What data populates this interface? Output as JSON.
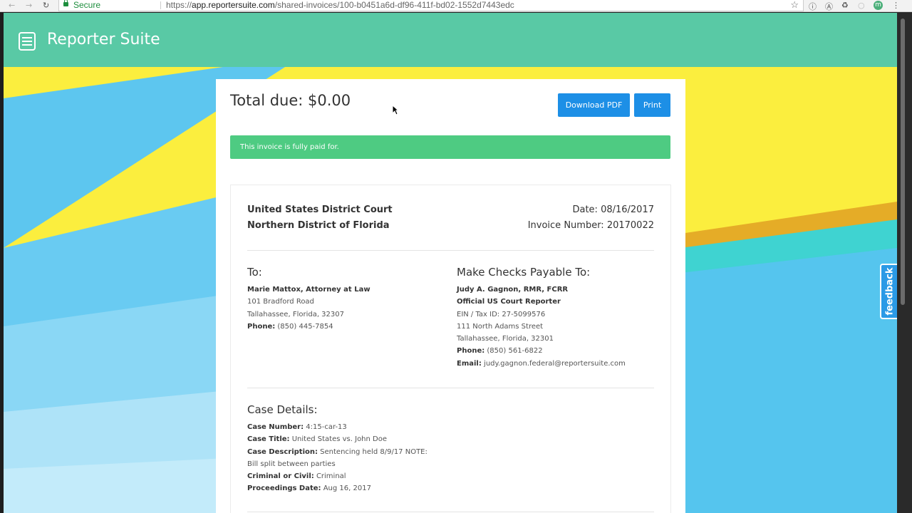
{
  "browser": {
    "secure_label": "Secure",
    "url_scheme": "https://",
    "url_host": "app.reportersuite.com",
    "url_path": "/shared-invoices/100-b0451a6d-df96-411f-bd02-1552d7443edc"
  },
  "app": {
    "brand": "Reporter Suite"
  },
  "feedback": {
    "label": "feedback"
  },
  "invoice": {
    "total_due": "Total due: $0.00",
    "download_label": "Download PDF",
    "print_label": "Print",
    "status_message": "This invoice is fully paid for.",
    "court": {
      "line1": "United States District Court",
      "line2": "Northern District of Florida"
    },
    "date": "Date: 08/16/2017",
    "invoice_number": "Invoice Number: 20170022",
    "to": {
      "heading": "To:",
      "name": "Marie Mattox, Attorney at Law",
      "street": "101 Bradford Road",
      "city": "Tallahassee, Florida, 32307",
      "phone_label": "Phone:",
      "phone": "(850) 445-7854"
    },
    "payable": {
      "heading": "Make Checks Payable To:",
      "name": "Judy A. Gagnon, RMR, FCRR",
      "title": "Official US Court Reporter",
      "ein": "EIN / Tax ID: 27-5099576",
      "street": "111 North Adams Street",
      "city": "Tallahassee, Florida, 32301",
      "phone_label": "Phone:",
      "phone": "(850) 561-6822",
      "email_label": "Email:",
      "email": "judy.gagnon.federal@reportersuite.com"
    },
    "case": {
      "heading": "Case Details:",
      "number_label": "Case Number:",
      "number": "4:15-car-13",
      "title_label": "Case Title:",
      "title": "United States vs. John Doe",
      "description_label": "Case Description:",
      "description": "Sentencing held 8/9/17 NOTE: Bill split between parties",
      "type_label": "Criminal or Civil:",
      "type": "Criminal",
      "date_label": "Proceedings Date:",
      "date": "Aug 16, 2017"
    }
  }
}
